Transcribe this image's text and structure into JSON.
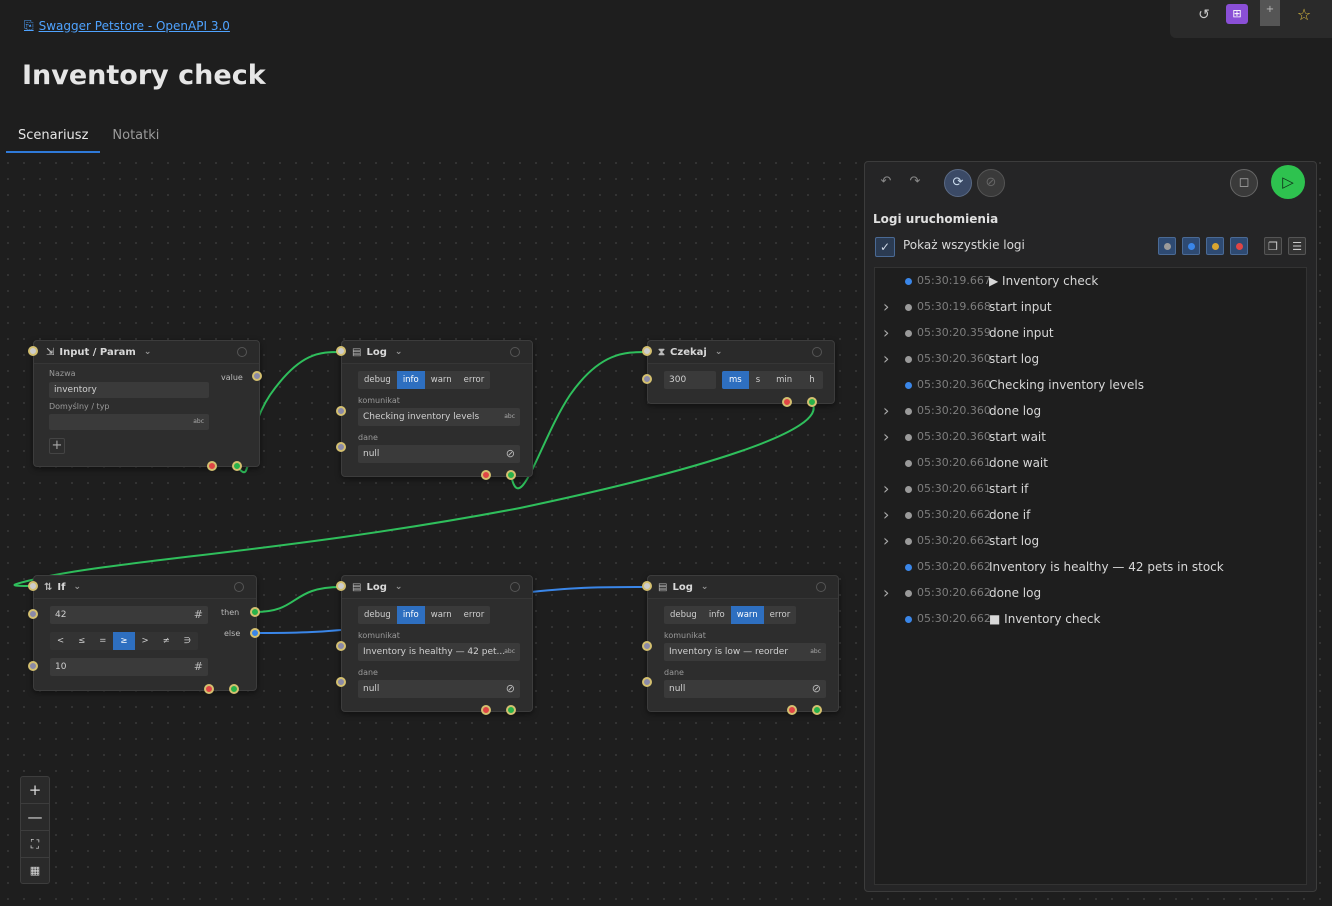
{
  "header": {
    "breadcrumb": "Swagger Petstore - OpenAPI 3.0",
    "title": "Inventory check",
    "tabs": [
      {
        "label": "Scenariusz",
        "active": true
      },
      {
        "label": "Notatki",
        "active": false
      }
    ]
  },
  "nodes": {
    "input": {
      "title": "Input / Param",
      "name_label": "Nazwa",
      "name_value": "inventory",
      "default_label": "Domyślny / typ",
      "default_value": "",
      "type_badge": "abc",
      "port_label": "value"
    },
    "log1": {
      "title": "Log",
      "levels": [
        "debug",
        "info",
        "warn",
        "error"
      ],
      "selected_level": "info",
      "message_label": "komunikat",
      "message": "Checking inventory levels",
      "data_label": "dane",
      "data": "null",
      "badge": "abc"
    },
    "wait": {
      "title": "Czekaj",
      "value": "300",
      "units": [
        "ms",
        "s",
        "min",
        "h"
      ],
      "selected_unit": "ms"
    },
    "if": {
      "title": "If",
      "left_value": "42",
      "operators": [
        "<",
        "≤",
        "=",
        "≥",
        ">",
        "≠",
        "∋"
      ],
      "selected_operator": "≥",
      "right_value": "10",
      "then_label": "then",
      "else_label": "else",
      "hash": "#"
    },
    "log2": {
      "title": "Log",
      "levels": [
        "debug",
        "info",
        "warn",
        "error"
      ],
      "selected_level": "info",
      "message_label": "komunikat",
      "message": "Inventory is healthy — 42 pet...",
      "data_label": "dane",
      "data": "null",
      "badge": "abc"
    },
    "log3": {
      "title": "Log",
      "levels": [
        "debug",
        "info",
        "warn",
        "error"
      ],
      "selected_level": "warn",
      "message_label": "komunikat",
      "message": "Inventory is low — reorder",
      "data_label": "dane",
      "data": "null",
      "badge": "abc"
    }
  },
  "zoom": {
    "zoom_in": "+",
    "zoom_out": "—"
  },
  "panel": {
    "title": "Logi uruchomienia",
    "show_all_label": "Pokaż wszystkie logi",
    "show_all_checked": true,
    "filter_colors": [
      "#9a9a9a",
      "#3a86e8",
      "#d9a530",
      "#e04545"
    ],
    "logs": [
      {
        "expandable": false,
        "color": "#3a86e8",
        "time": "05:30:19.667",
        "message": "▶ Inventory check"
      },
      {
        "expandable": true,
        "color": "#9a9a9a",
        "time": "05:30:19.668",
        "message": "start input"
      },
      {
        "expandable": true,
        "color": "#9a9a9a",
        "time": "05:30:20.359",
        "message": "done input"
      },
      {
        "expandable": true,
        "color": "#9a9a9a",
        "time": "05:30:20.360",
        "message": "start log"
      },
      {
        "expandable": false,
        "color": "#3a86e8",
        "time": "05:30:20.360",
        "message": "Checking inventory levels"
      },
      {
        "expandable": true,
        "color": "#9a9a9a",
        "time": "05:30:20.360",
        "message": "done log"
      },
      {
        "expandable": true,
        "color": "#9a9a9a",
        "time": "05:30:20.360",
        "message": "start wait"
      },
      {
        "expandable": false,
        "color": "#9a9a9a",
        "time": "05:30:20.661",
        "message": "done wait"
      },
      {
        "expandable": true,
        "color": "#9a9a9a",
        "time": "05:30:20.661",
        "message": "start if"
      },
      {
        "expandable": true,
        "color": "#9a9a9a",
        "time": "05:30:20.662",
        "message": "done if"
      },
      {
        "expandable": true,
        "color": "#9a9a9a",
        "time": "05:30:20.662",
        "message": "start log"
      },
      {
        "expandable": false,
        "color": "#3a86e8",
        "time": "05:30:20.662",
        "message": "Inventory is healthy — 42 pets in stock"
      },
      {
        "expandable": true,
        "color": "#9a9a9a",
        "time": "05:30:20.662",
        "message": "done log"
      },
      {
        "expandable": false,
        "color": "#3a86e8",
        "time": "05:30:20.662",
        "message": "■ Inventory check"
      }
    ]
  }
}
